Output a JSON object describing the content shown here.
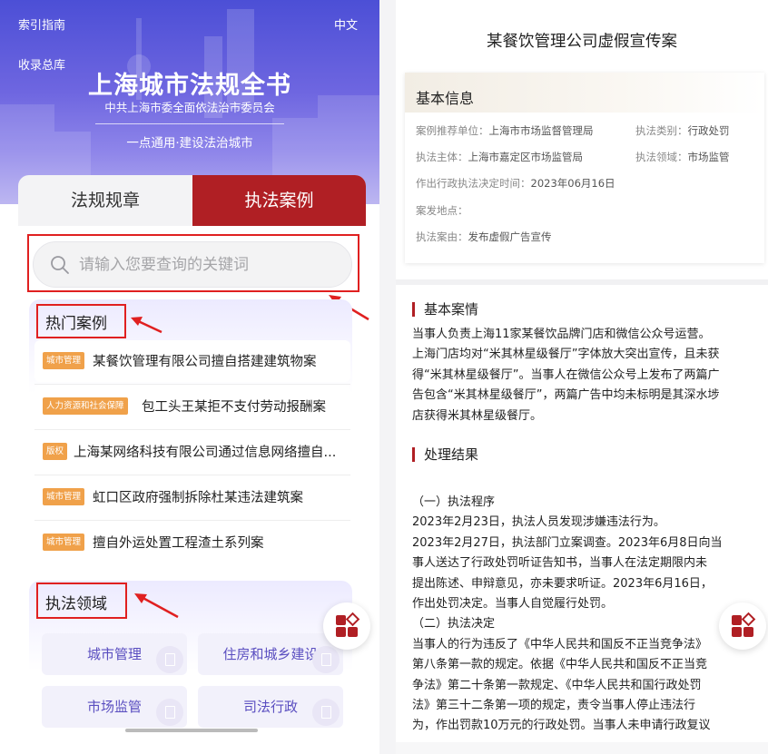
{
  "left": {
    "banner": {
      "index_guide": "索引指南",
      "language": "中文",
      "collection": "收录总库",
      "title": "上海城市法规全书",
      "subtitle": "中共上海市委全面依法治市委员会",
      "slogan": "一点通用·建设法治城市"
    },
    "tabs": [
      {
        "label": "法规规章",
        "active": false
      },
      {
        "label": "执法案例",
        "active": true
      }
    ],
    "search": {
      "placeholder": "请输入您要查询的关键词",
      "value": ""
    },
    "hot_cases": {
      "title": "热门案例",
      "items": [
        {
          "tag": "城市管理",
          "title": "某餐饮管理有限公司擅自搭建建筑物案"
        },
        {
          "tag": "人力资源和社会保障",
          "title": "包工头王某拒不支付劳动报酬案"
        },
        {
          "tag": "版权",
          "title": "上海某网络科技有限公司通过信息网络擅自..."
        },
        {
          "tag": "城市管理",
          "title": "虹口区政府强制拆除杜某违法建筑案"
        },
        {
          "tag": "城市管理",
          "title": "擅自外运处置工程渣土系列案"
        }
      ]
    },
    "fields": {
      "title": "执法领域",
      "items": [
        "城市管理",
        "住房和城乡建设",
        "市场监管",
        "司法行政"
      ]
    },
    "colors": {
      "accent": "#b01f24",
      "tag": "#f0a14a",
      "annotation": "#e02020"
    }
  },
  "right": {
    "title": "某餐饮管理公司虚假宣传案",
    "basic_info": {
      "heading": "基本信息",
      "recommend_label": "案例推荐单位：",
      "recommend_value": "上海市市场监督管理局",
      "category_label": "执法类别：",
      "category_value": "行政处罚",
      "subject_label": "执法主体：",
      "subject_value": "上海市嘉定区市场监管局",
      "field_label": "执法领域：",
      "field_value": "市场监管",
      "decision_time_label": "作出行政执法决定时间：",
      "decision_time_value": "2023年06月16日",
      "location_label": "案发地点：",
      "location_value": "",
      "cause_label": "执法案由：",
      "cause_value": "发布虚假广告宣传"
    },
    "section_basic": {
      "heading": "基本案情",
      "lines": [
        "当事人负责上海11家某餐饮品牌门店和微信公众号运营。",
        "上海门店均对“米其林星级餐厅”字体放大突出宣传，且未获",
        "得“米其林星级餐厅”。当事人在微信公众号上发布了两篇广",
        "告包含“米其林星级餐厅”，两篇广告中均未标明是其深水埗",
        "店获得米其林星级餐厅。"
      ]
    },
    "section_result": {
      "heading": "处理结果",
      "lines": [
        "（一）执法程序",
        "2023年2月23日，执法人员发现涉嫌违法行为。",
        "2023年2月27日，执法部门立案调查。2023年6月8日向当",
        "事人送达了行政处罚听证告知书，当事人在法定期限内未",
        "提出陈述、申辩意见，亦未要求听证。2023年6月16日，",
        "作出处罚决定。当事人自觉履行处罚。",
        "（二）执法决定",
        "当事人的行为违反了《中华人民共和国反不正当竞争法》",
        "第八条第一款的规定。依据《中华人民共和国反不正当竞",
        "争法》第二十条第一款规定、《中华人民共和国行政处罚",
        "法》第三十二条第一项的规定，责令当事人停止违法行",
        "为，作出罚款10万元的行政处罚。当事人未申请行政复议"
      ]
    }
  }
}
